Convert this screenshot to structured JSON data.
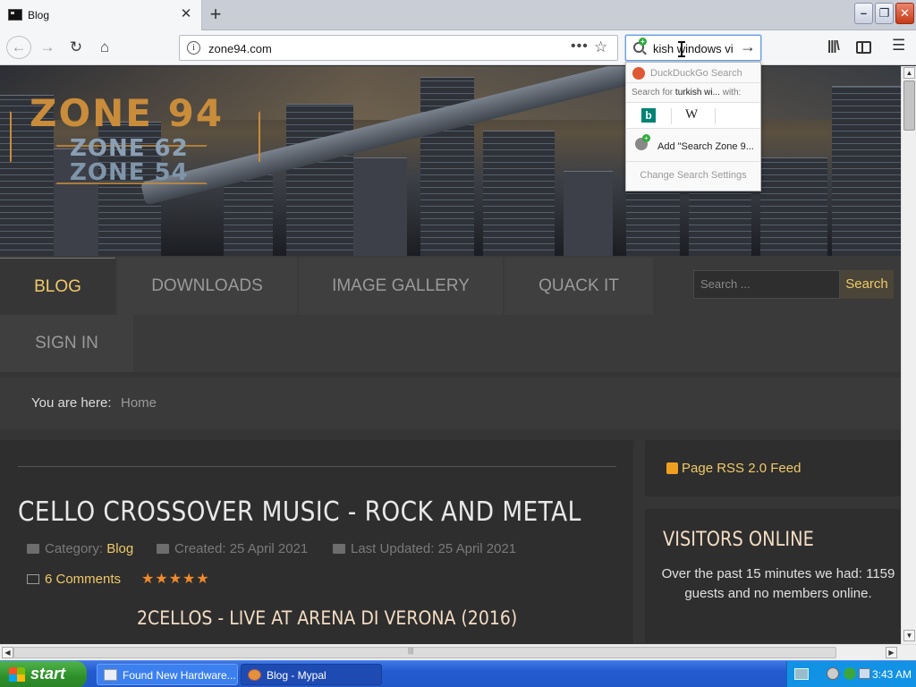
{
  "browser": {
    "tab_title": "Blog",
    "new_tab_symbol": "+",
    "tab_close_symbol": "✕",
    "url": "zone94.com",
    "search_query": "kish windows vi",
    "icons": [
      "back-icon",
      "forward-icon",
      "reload-icon",
      "home-icon",
      "info-icon",
      "page-actions-icon",
      "bookmark-star-icon",
      "library-icon",
      "sidebar-icon",
      "menu-icon"
    ]
  },
  "search_dropdown": {
    "engine_label": "DuckDuckGo Search",
    "search_for_prefix": "Search for",
    "search_for_term": "turkish wi...",
    "search_for_suffix": "with:",
    "bing_glyph": "b",
    "wiki_glyph": "W",
    "add_label": "Add \"Search Zone 9...",
    "settings_label": "Change Search Settings"
  },
  "site": {
    "logo_main": "ZONE 94",
    "logo_sub1": "ZONE 62",
    "logo_sub2": "ZONE 54",
    "menu": {
      "blog": "BLOG",
      "downloads": "DOWNLOADS",
      "gallery": "IMAGE GALLERY",
      "quack": "QUACK IT",
      "signin": "SIGN IN"
    },
    "search_placeholder": "Search ...",
    "search_button": "Search",
    "breadcrumb_label": "You are here:",
    "breadcrumb_home": "Home",
    "accent_color": "#f0c969"
  },
  "article": {
    "title": "CELLO CROSSOVER MUSIC - ROCK AND METAL",
    "category_label": "Category:",
    "category": "Blog",
    "created": "Created: 25 April 2021",
    "updated": "Last Updated: 25 April 2021",
    "comments": "6 Comments",
    "stars": "★★★★★",
    "subtitle": "2CELLOS - LIVE AT ARENA DI VERONA (2016)"
  },
  "sidebar": {
    "rss": "Page RSS 2.0 Feed",
    "visitors_title": "VISITORS ONLINE",
    "visitors_text": "Over the past 15 minutes we had: 1159 guests and no members online."
  },
  "taskbar": {
    "start": "start",
    "task_hardware": "Found New Hardware...",
    "task_blog": "Blog - Mypal",
    "clock": "3:43 AM"
  }
}
